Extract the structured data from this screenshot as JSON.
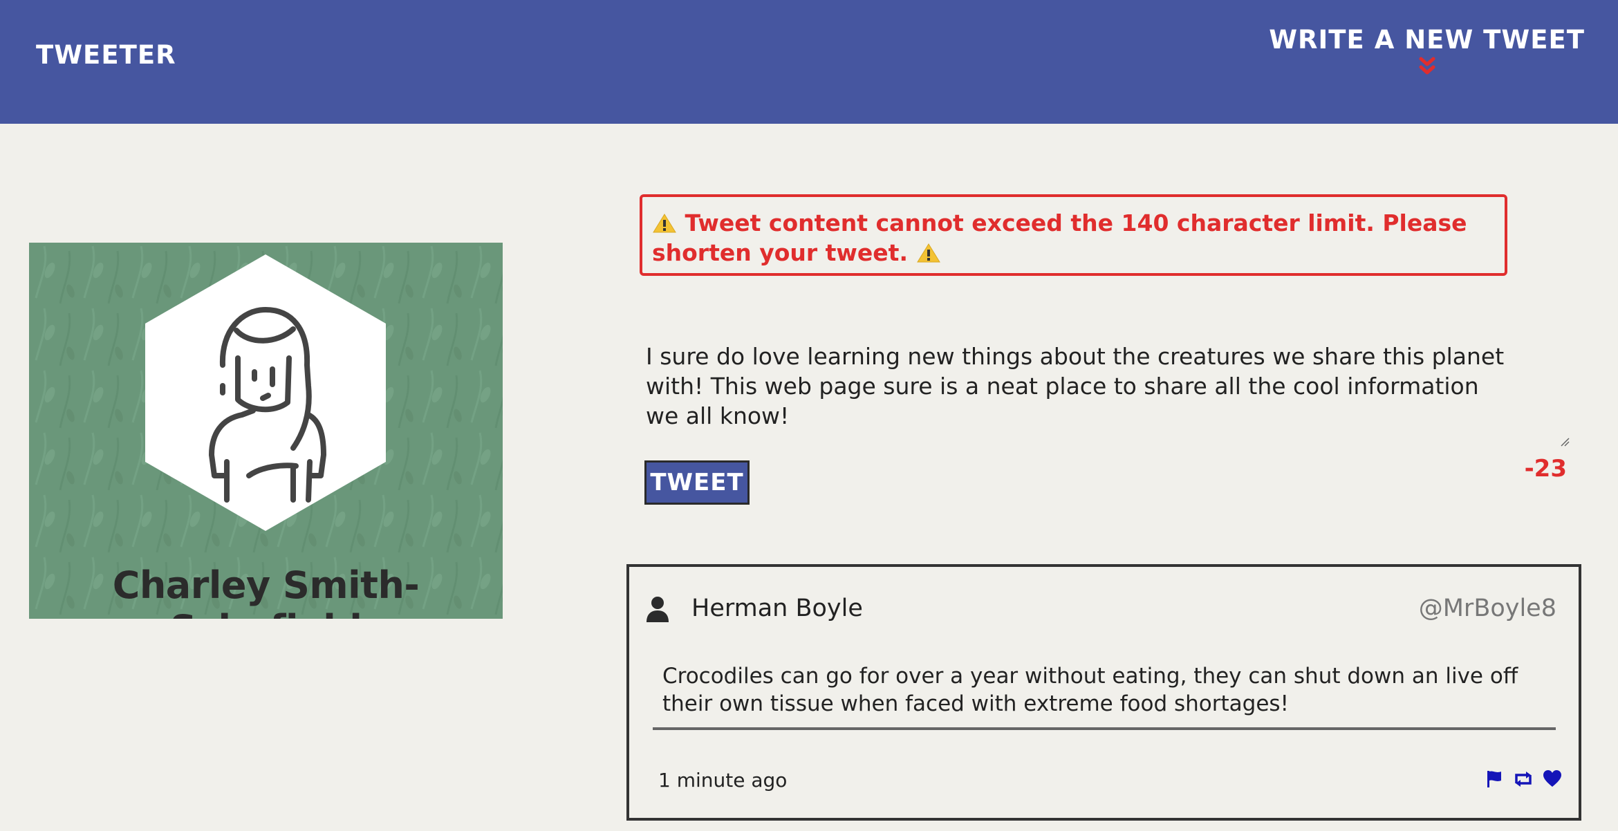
{
  "nav": {
    "brand": "TWEETER",
    "write_new_label": "WRITE A NEW TWEET"
  },
  "colors": {
    "nav_bg": "#4656a0",
    "accent_red": "#e02d2d",
    "action_blue": "#1515b8",
    "profile_bg": "#6a977a"
  },
  "profile": {
    "name": "Charley Smith-Schofield"
  },
  "compose": {
    "error_message": "Tweet content cannot exceed the 140 character limit. Please shorten your tweet.",
    "text": "I sure do love learning new things about the creatures we share this planet with! This web page sure is a neat place to share all the cool information we all know!",
    "submit_label": "TWEET",
    "counter": "-23"
  },
  "tweets": [
    {
      "author": "Herman Boyle",
      "handle": "@MrBoyle8",
      "content": "Crocodiles can go for over a year without eating, they can shut down an live off their own tissue when faced with extreme food shortages!",
      "time": "1 minute ago",
      "actions": [
        "flag-icon",
        "retweet-icon",
        "heart-icon"
      ]
    }
  ]
}
